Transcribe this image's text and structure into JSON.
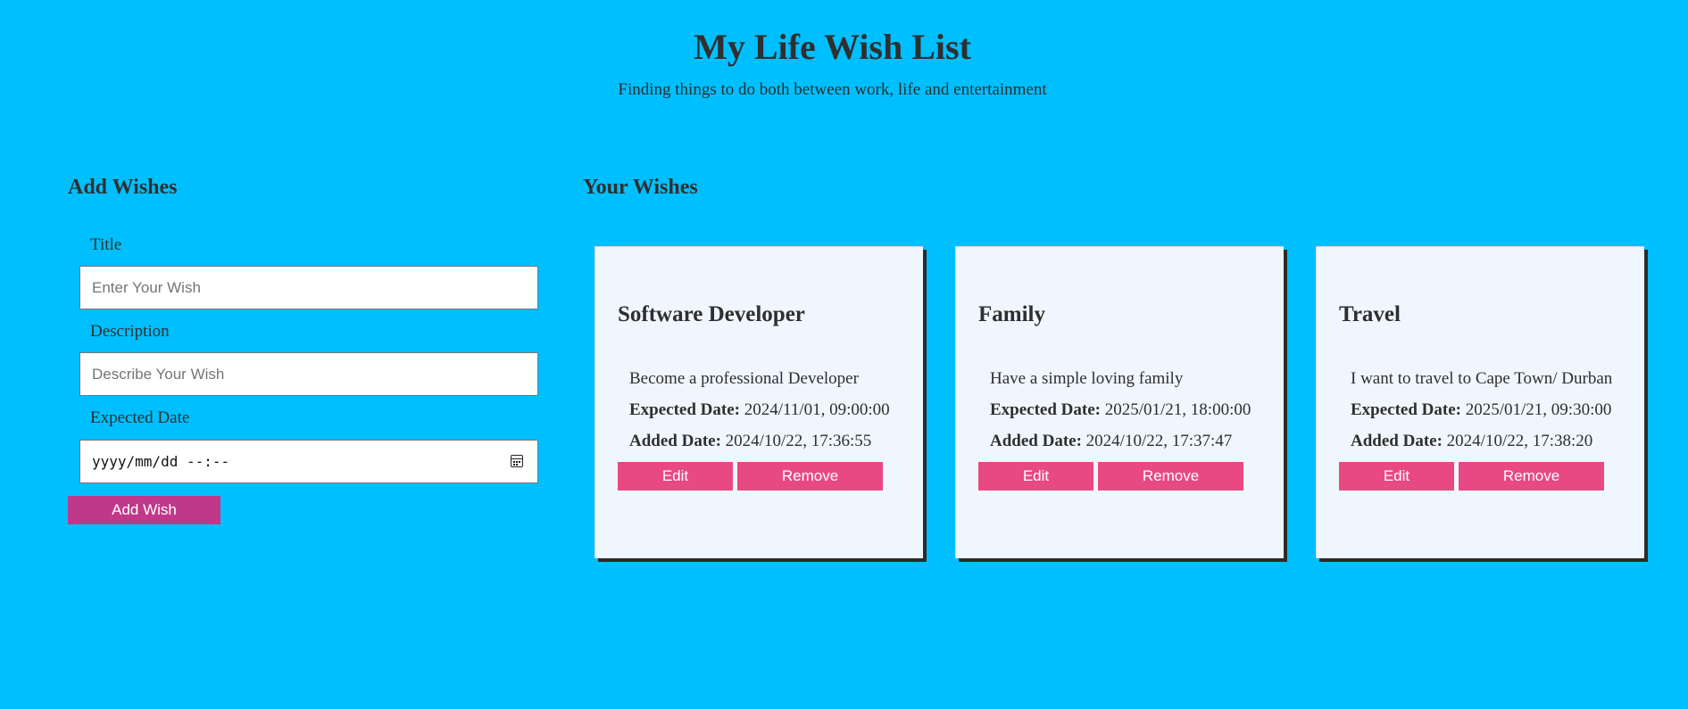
{
  "header": {
    "title": "My Life Wish List",
    "subtitle": "Finding things to do both between work, life and entertainment"
  },
  "add_form": {
    "heading": "Add Wishes",
    "title_label": "Title",
    "title_placeholder": "Enter Your Wish",
    "description_label": "Description",
    "description_placeholder": "Describe Your Wish",
    "date_label": "Expected Date",
    "date_placeholder": "yyyy/mm/dd --:--",
    "submit_label": "Add Wish"
  },
  "wishes": {
    "heading": "Your Wishes",
    "expected_label": "Expected Date:",
    "added_label": "Added Date:",
    "edit_label": "Edit",
    "remove_label": "Remove",
    "items": [
      {
        "title": "Software Developer",
        "description": "Become a professional Developer",
        "expected_date": "2024/11/01, 09:00:00",
        "added_date": "2024/10/22, 17:36:55"
      },
      {
        "title": "Family",
        "description": "Have a simple loving family",
        "expected_date": "2025/01/21, 18:00:00",
        "added_date": "2024/10/22, 17:37:47"
      },
      {
        "title": "Travel",
        "description": "I want to travel to Cape Town/ Durban",
        "expected_date": "2025/01/21, 09:30:00",
        "added_date": "2024/10/22, 17:38:20"
      }
    ]
  },
  "colors": {
    "background": "#00bfff",
    "card_background": "#eff6fd",
    "primary_button": "#c0388a",
    "card_button": "#e84983",
    "text": "#2f2f2f"
  }
}
